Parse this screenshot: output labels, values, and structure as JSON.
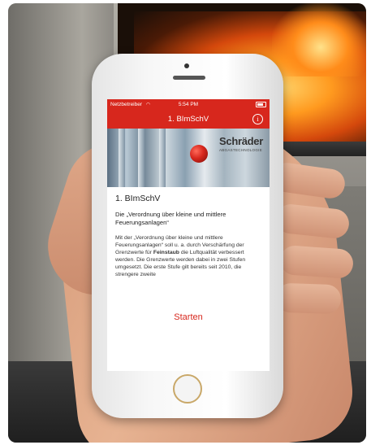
{
  "status_bar": {
    "carrier": "Netzbetreiber",
    "wifi_icon": "wifi-icon",
    "time": "5:54 PM",
    "battery_icon": "battery-icon"
  },
  "nav_bar": {
    "title": "1. BImSchV",
    "info_icon": "info-icon",
    "info_glyph": "i"
  },
  "hero": {
    "logo_name": "Schräder",
    "logo_subtitle": "ABGASTECHNOLOGIE"
  },
  "article": {
    "heading": "1. BImSchV",
    "lead": "Die „Verordnung über kleine und mittlere Feuerungsanlagen“",
    "body_part1": "Mit der „Verordnung über kleine und mittlere Feuerungsanlagen“ soll u. a. durch Verschärfung der Grenzwerte für ",
    "body_bold": "Feinstaub",
    "body_part2": " die Luftqualität verbessert werden. Die Grenzwerte werden dabei in zwei Stufen umgesetzt. Die erste Stufe gilt bereits seit 2010, die strengere zweite"
  },
  "actions": {
    "start_label": "Starten"
  },
  "colors": {
    "accent": "#d7271d"
  }
}
